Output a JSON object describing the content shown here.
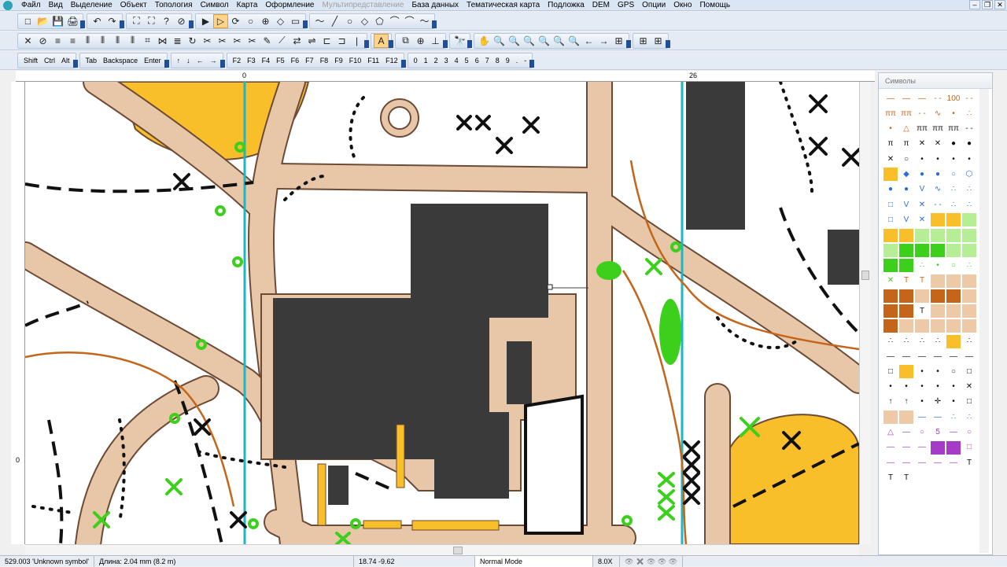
{
  "menu": {
    "items": [
      "Файл",
      "Вид",
      "Выделение",
      "Объект",
      "Топология",
      "Символ",
      "Карта",
      "Оформление",
      "Мультипредставление",
      "База данных",
      "Тематическая карта",
      "Подложка",
      "DEM",
      "GPS",
      "Опции",
      "Окно",
      "Помощь"
    ],
    "disabled": [
      "Мультипредставление"
    ]
  },
  "toolbar1": {
    "groups": [
      [
        "□",
        "📂",
        "💾",
        "🖨"
      ],
      [
        "↶",
        "↷"
      ],
      [
        "⛶",
        "⛶",
        "?",
        "⊘"
      ],
      [
        "▶",
        "▷",
        "⟳",
        "○",
        "⊕",
        "◇",
        "▭"
      ],
      [
        "〜",
        "╱",
        "○",
        "◇",
        "⬠",
        "⌒",
        "⌒",
        "〜"
      ]
    ]
  },
  "toolbar2": {
    "groups": [
      [
        "✕",
        "⊘",
        "≡",
        "≡",
        "⦀",
        "⦀",
        "⦀",
        "⦀",
        "⌗",
        "⋈",
        "≣",
        "↻",
        "✂",
        "✂",
        "✂",
        "✂",
        "✎",
        "⟋",
        "⇄",
        "⇌",
        "⊏",
        "⊐",
        "|"
      ],
      [
        "A"
      ],
      [
        "⧉",
        "⊕",
        "⊥"
      ],
      [
        "🔭"
      ],
      [
        "✋",
        "🔍",
        "🔍",
        "🔍",
        "🔍",
        "🔍",
        "🔍",
        "←",
        "→",
        "⊞"
      ],
      [
        "⊞",
        "⊞"
      ]
    ]
  },
  "keyboard": {
    "modifiers": [
      "Shift",
      "Ctrl",
      "Alt"
    ],
    "keys": [
      "Tab",
      "Backspace",
      "Enter"
    ],
    "arrows": [
      "↑",
      "↓",
      "←",
      "→"
    ],
    "fkeys": [
      "F2",
      "F3",
      "F4",
      "F5",
      "F6",
      "F7",
      "F8",
      "F9",
      "F10",
      "F11",
      "F12"
    ],
    "digits": [
      "0",
      "1",
      "2",
      "3",
      "4",
      "5",
      "6",
      "7",
      "8",
      "9",
      ".",
      "-"
    ]
  },
  "rulers": {
    "h_labels": [
      "0",
      "26"
    ],
    "v_label": "0"
  },
  "symbols_panel": {
    "title": "Символы",
    "colors": {
      "brown": "#c4651a",
      "tan": "#edc9a8",
      "yellow": "#f9bf2a",
      "green": "#3ccf1c",
      "blue": "#2a6fd8",
      "black": "#111111",
      "purple": "#a43cc8",
      "light_green": "#b6ee96"
    }
  },
  "map": {
    "colors": {
      "tan": "#e8c7a8",
      "road_edge": "#6d4a36",
      "building": "#3a3a3a",
      "yellow": "#f9bf2a",
      "green": "#3ccf1c",
      "cyan": "#1cb6c4",
      "brown": "#c4651a"
    }
  },
  "status": {
    "symbol": "529.003 'Unknown symbol'",
    "length": "Длина: 2.04 mm (8.2 m)",
    "coords": "18.74   -9.62",
    "mode": "Normal Mode",
    "zoom": "8.0X"
  }
}
